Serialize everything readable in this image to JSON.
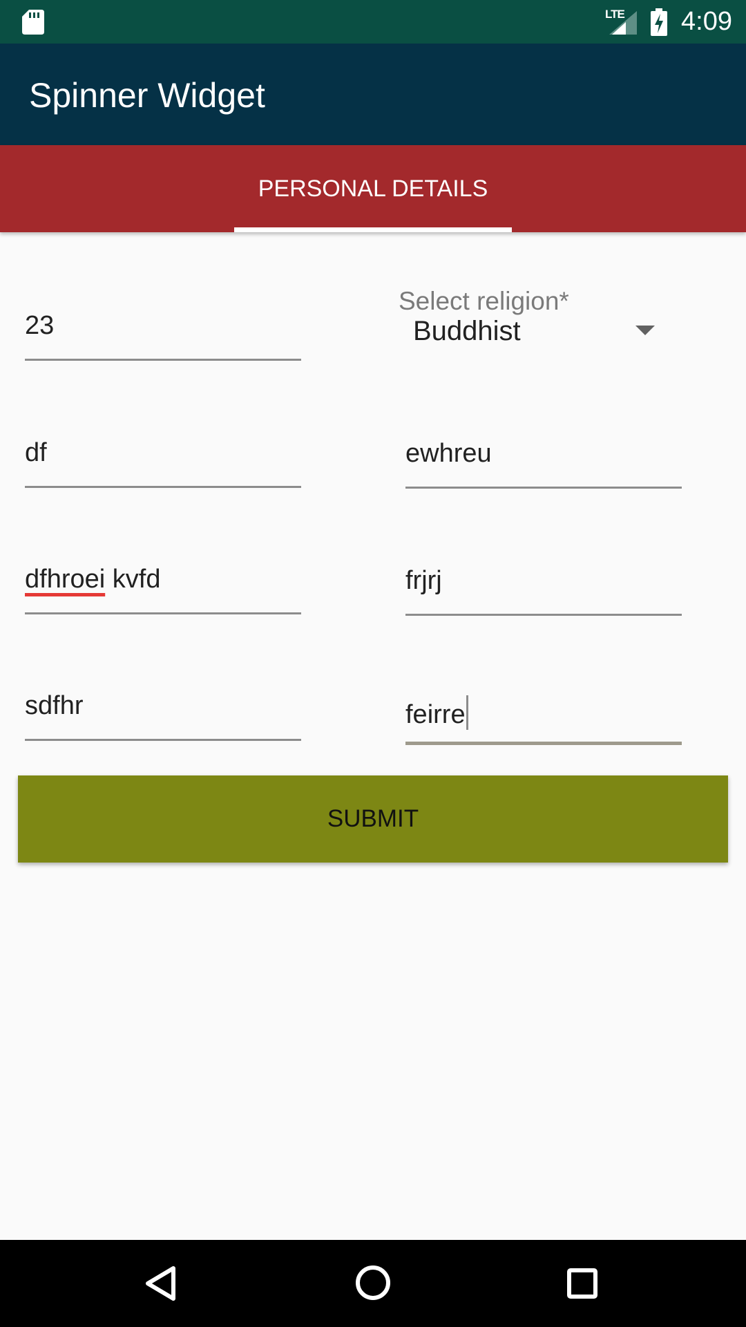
{
  "status_bar": {
    "time": "4:09",
    "network": "LTE",
    "icons": [
      "sd-card-icon",
      "signal-icon",
      "battery-charging-icon"
    ]
  },
  "app_bar": {
    "title": "Spinner Widget"
  },
  "tabs": [
    {
      "label": "PERSONAL DETAILS",
      "selected": true
    }
  ],
  "form": {
    "fields": [
      {
        "value": "23"
      },
      {
        "value": "df"
      },
      {
        "value": "ewhreu"
      },
      {
        "value_misspelled": "dfhroei",
        "value_rest": " kvfd"
      },
      {
        "value": "frjrj"
      },
      {
        "value": "sdfhr"
      },
      {
        "value": "feirre",
        "focused": true
      }
    ],
    "religion_spinner": {
      "label": "Select religion*",
      "selected": "Buddhist"
    },
    "submit_label": "SUBMIT"
  },
  "nav_bar": {
    "icons": [
      "back-icon",
      "home-icon",
      "recents-icon"
    ]
  },
  "colors": {
    "status_bar": "#0A4F43",
    "app_bar": "#053146",
    "tab_bar": "#A3292C",
    "submit_button": "#7D8714",
    "background": "#FAFAFA"
  }
}
